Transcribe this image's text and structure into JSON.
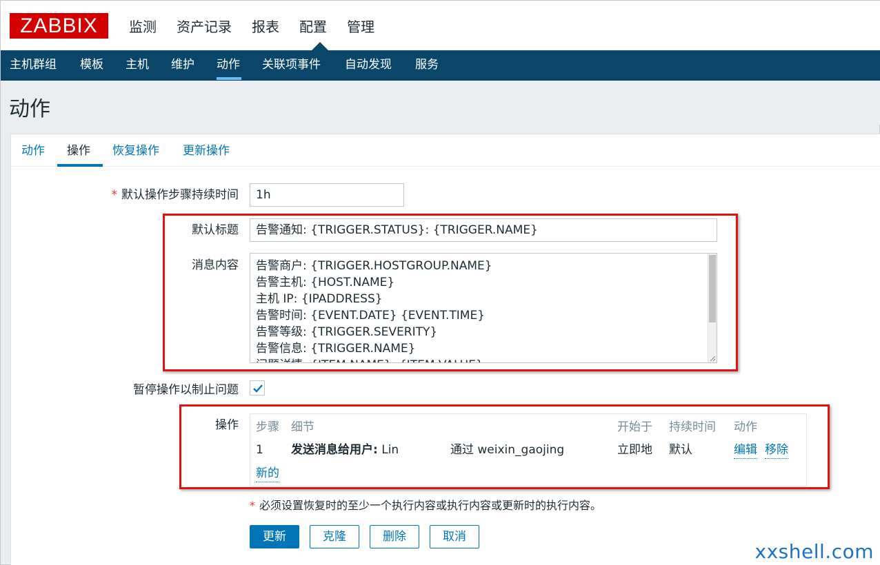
{
  "logo": "ZABBIX",
  "main_menu": [
    "监测",
    "资产记录",
    "报表",
    "配置",
    "管理"
  ],
  "main_menu_active": "配置",
  "sub_menu": [
    "主机群组",
    "模板",
    "主机",
    "维护",
    "动作",
    "关联项事件",
    "自动发现",
    "服务"
  ],
  "sub_menu_active": "动作",
  "page_title": "动作",
  "tabs": [
    "动作",
    "操作",
    "恢复操作",
    "更新操作"
  ],
  "tab_active": "操作",
  "form": {
    "step_duration_label": "默认操作步骤持续时间",
    "step_duration_required": "*",
    "step_duration_value": "1h",
    "subject_label": "默认标题",
    "subject_value": "告警通知: {TRIGGER.STATUS}: {TRIGGER.NAME}",
    "message_label": "消息内容",
    "message_lines": [
      "告警商户: {TRIGGER.HOSTGROUP.NAME}",
      "告警主机: {HOST.NAME}",
      "主机 IP: {IPADDRESS}",
      "告警时间: {EVENT.DATE} {EVENT.TIME}",
      "告警等级: {TRIGGER.SEVERITY}",
      "告警信息: {TRIGGER.NAME}",
      "问题详情: {ITEM.NAME}: {ITEM.VALUE}"
    ],
    "pause_label": "暂停操作以制止问题",
    "pause_checked": true,
    "operations_label": "操作"
  },
  "operations": {
    "headers": [
      "步骤",
      "细节",
      "开始于",
      "持续时间",
      "动作"
    ],
    "rows": [
      {
        "step": "1",
        "detail_bold": "发送消息给用户:",
        "detail_user": "Lin",
        "detail_via": "通过 weixin_gaojing",
        "start": "立即地",
        "duration": "默认",
        "edit": "编辑",
        "remove": "移除"
      }
    ],
    "new_link": "新的"
  },
  "note_star": "*",
  "note_text": "必须设置恢复时的至少一个执行内容或执行内容或更新时的执行内容。",
  "buttons": {
    "update": "更新",
    "clone": "克隆",
    "delete": "删除",
    "cancel": "取消"
  },
  "watermark": "xxshell.com",
  "colors": {
    "brand_red": "#d40000",
    "nav_blue": "#0a466a",
    "link_blue": "#0275b8",
    "annotation_red": "#e01212"
  }
}
